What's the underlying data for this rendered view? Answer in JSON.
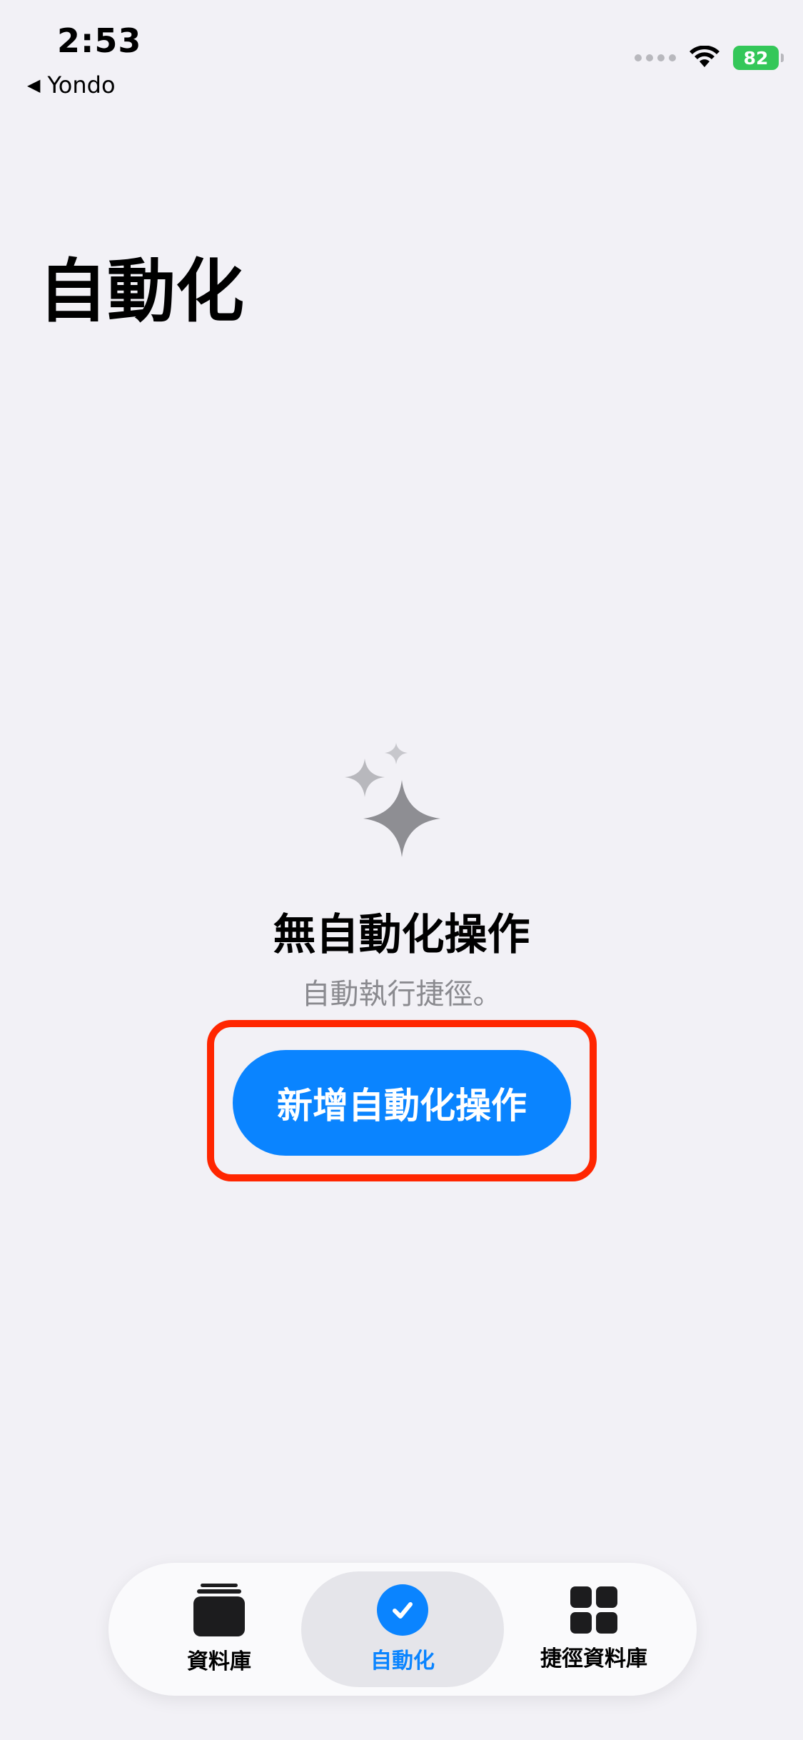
{
  "status_bar": {
    "time": "2:53",
    "back_label": "Yondo",
    "battery_level": "82"
  },
  "header": {
    "title": "自動化"
  },
  "empty_state": {
    "icon": "sparkles-icon",
    "title": "無自動化操作",
    "subtitle": "自動執行捷徑。",
    "button_label": "新增自動化操作"
  },
  "tab_bar": {
    "tabs": [
      {
        "label": "資料庫",
        "icon": "library-stack-icon",
        "selected": false
      },
      {
        "label": "自動化",
        "icon": "automation-check-icon",
        "selected": true
      },
      {
        "label": "捷徑資料庫",
        "icon": "gallery-grid-icon",
        "selected": false
      }
    ]
  },
  "colors": {
    "accent": "#0a84ff",
    "highlight": "#ff2600",
    "background": "#f2f1f6",
    "battery": "#34c759"
  }
}
